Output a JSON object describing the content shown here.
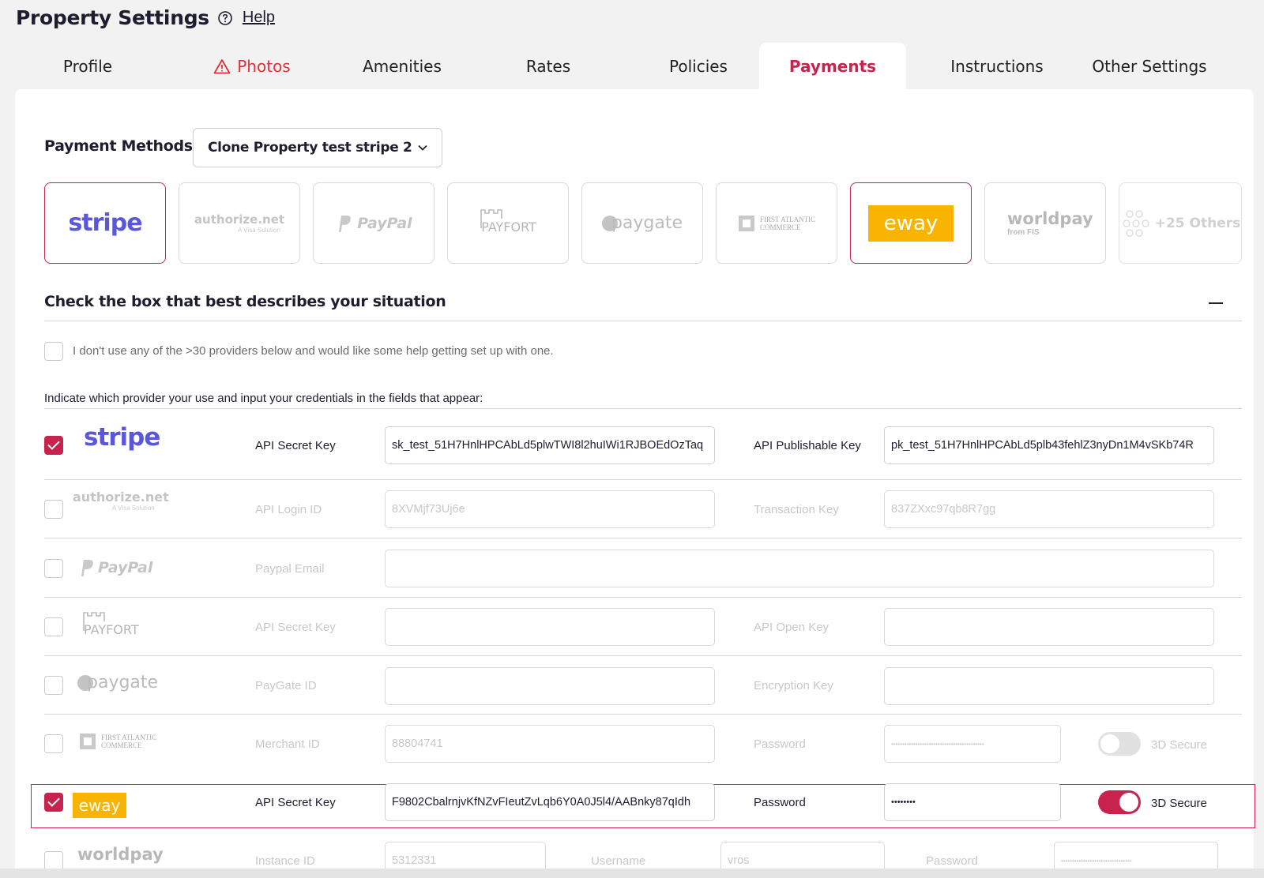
{
  "header": {
    "title": "Property Settings",
    "help": "Help"
  },
  "tabs": [
    {
      "label": "Profile"
    },
    {
      "label": "Photos"
    },
    {
      "label": "Amenities"
    },
    {
      "label": "Rates"
    },
    {
      "label": "Policies"
    },
    {
      "label": "Payments"
    },
    {
      "label": "Instructions"
    },
    {
      "label": "Other Settings"
    }
  ],
  "payment_methods": {
    "label": "Payment Methods",
    "selected": "Clone Property test stripe 2",
    "tiles": {
      "stripe": "stripe",
      "authorize": "authorize.net",
      "authorize_sub": "A Visa Solution",
      "paypal": "PayPal",
      "payfort": "PAYFORT",
      "paygate": "paygate",
      "fac": "FIRST ATLANTIC COMMERCE",
      "eway": "eway",
      "worldpay": "worldpay",
      "worldpay_sub": "from FIS",
      "others": "+25 Others"
    }
  },
  "section": {
    "title": "Check the box that best describes your situation",
    "help_option": "I don't use any of the >30 providers below and would like some help getting set up with one.",
    "indicate": "Indicate which provider your use and input your credentials in the fields that appear:"
  },
  "providers": {
    "stripe": {
      "label1": "API Secret Key",
      "value1": "sk_test_51H7HnlHPCAbLd5plwTWI8l2huIWi1RJBOEdOzTaq",
      "label2": "API Publishable Key",
      "value2": "pk_test_51H7HnlHPCAbLd5plb43fehlZ3nyDn1M4vSKb74R"
    },
    "authorize": {
      "label1": "API Login ID",
      "value1": "8XVMjf73Uj6e",
      "label2": "Transaction Key",
      "value2": "837ZXxc97qb8R7gg"
    },
    "paypal": {
      "label1": "Paypal Email",
      "value1": ""
    },
    "payfort": {
      "label1": "API Secret Key",
      "value1": "",
      "label2": "API Open Key",
      "value2": ""
    },
    "paygate": {
      "label1": "PayGate ID",
      "value1": "",
      "label2": "Encryption Key",
      "value2": ""
    },
    "fac": {
      "label1": "Merchant ID",
      "value1": "88804741",
      "label2": "Password",
      "value2": "••••••••••••••••••••••••••••••••••••••••••",
      "toggle": "3D Secure"
    },
    "eway": {
      "label1": "API Secret Key",
      "value1": "F9802CbalrnjvKfNZvFIeutZvLqb6Y0A0J5l4/AABnky87qIdh",
      "label2": "Password",
      "value2": "••••••••",
      "toggle": "3D Secure"
    },
    "worldpay": {
      "label1": "Instance ID",
      "value1": "5312331",
      "label2": "Username",
      "value2": "vros",
      "label3": "Password",
      "value3": "••••••••••••••••••••••••••••••••"
    }
  }
}
